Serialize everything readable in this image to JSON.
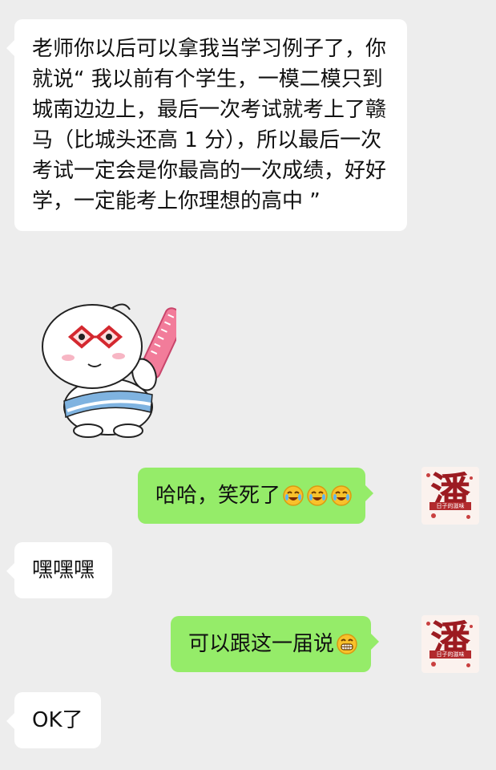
{
  "chat": {
    "messages": [
      {
        "side": "left",
        "text": "老师你以后可以拿我当学习例子了，你就说“ 我以前有个学生，一模二模只到城南边边上，最后一次考试就考上了赣马（比城头还高 1 分），所以最后一次考试一定会是你最高的一次成绩，好好学，一定能考上你理想的高中 ”"
      },
      {
        "side": "left",
        "type": "sticker",
        "icon": "cartoon-sticker"
      },
      {
        "side": "right",
        "text": "哈哈，笑死了",
        "emoji": [
          "laugh-cry-emoji",
          "laugh-cry-emoji",
          "laugh-cry-emoji"
        ]
      },
      {
        "side": "left",
        "text": "嘿嘿嘿"
      },
      {
        "side": "right",
        "text": "可以跟这一届说",
        "emoji": [
          "grin-emoji"
        ]
      },
      {
        "side": "left",
        "text": "OK了"
      }
    ],
    "avatar": {
      "char": "潘",
      "subtitle": "日子的滋味",
      "icon": "user-avatar-icon"
    }
  },
  "colors": {
    "background": "#ededed",
    "left_bubble": "#ffffff",
    "right_bubble": "#95ec69",
    "avatar_red": "#9c1b21"
  }
}
